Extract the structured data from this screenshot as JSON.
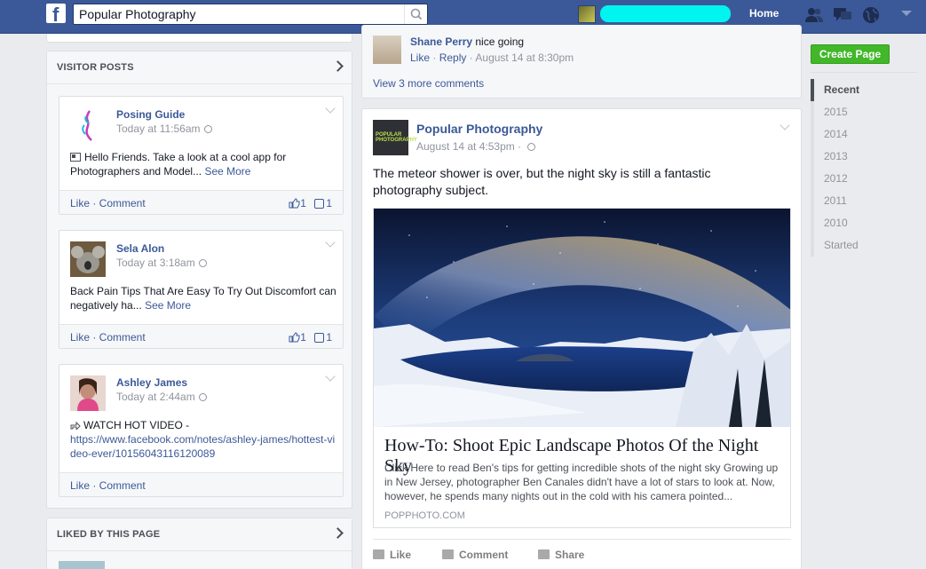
{
  "topbar": {
    "logo_text": "f",
    "search_value": "Popular Photography",
    "home_label": "Home"
  },
  "left": {
    "visitor_title": "VISITOR POSTS",
    "liked_title": "LIKED BY THIS PAGE",
    "posts": [
      {
        "name": "Posing Guide",
        "time": "Today at 11:56am",
        "body": "Hello Friends. Take a look at a cool app for Photographers and Model...",
        "see_more": "See More",
        "actions": "Like · Comment",
        "likes": "1",
        "comments": "1"
      },
      {
        "name": "Sela Alon",
        "time": "Today at 3:18am",
        "body": "Back Pain Tips That Are Easy To Try Out Discomfort can negatively ha...",
        "see_more": "See More",
        "actions": "Like · Comment",
        "likes": "1",
        "comments": "1"
      },
      {
        "name": "Ashley James",
        "time": "Today at 2:44am",
        "body_prefix": "WATCH HOT VIDEO -",
        "link": "https://www.facebook.com/notes/ashley-james/hottest-video-ever/10156043116120089",
        "actions": "Like · Comment"
      }
    ]
  },
  "feed": {
    "comment": {
      "author": "Shane Perry",
      "text": " nice going",
      "like": "Like",
      "reply": "Reply",
      "time": "August 14 at 8:30pm",
      "view_more": "View 3 more comments"
    },
    "post": {
      "logo_text": "POPULAR PHOTOGRAPHY",
      "page_name": "Popular Photography",
      "time": "August 14 at 4:53pm",
      "text": "The meteor shower is over, but the night sky is still a fantastic photography subject.",
      "link_title": "How-To: Shoot Epic Landscape Photos Of the Night Sky",
      "link_desc": "Click Here to read Ben's tips for getting incredible shots of the night sky Growing up in New Jersey, photographer Ben Canales didn't have a lot of stars to look at. Now, however, he spends many nights out in the cold with his camera pointed...",
      "link_domain": "POPPHOTO.COM",
      "like": "Like",
      "comment": "Comment",
      "share": "Share"
    }
  },
  "right": {
    "create_page": "Create Page",
    "timeline": [
      "Recent",
      "2015",
      "2014",
      "2013",
      "2012",
      "2011",
      "2010",
      "Started"
    ],
    "active_index": 0
  },
  "colors": {
    "brand_blue": "#3b5998",
    "create_green": "#42b72a",
    "redaction": "#00f5f0"
  }
}
